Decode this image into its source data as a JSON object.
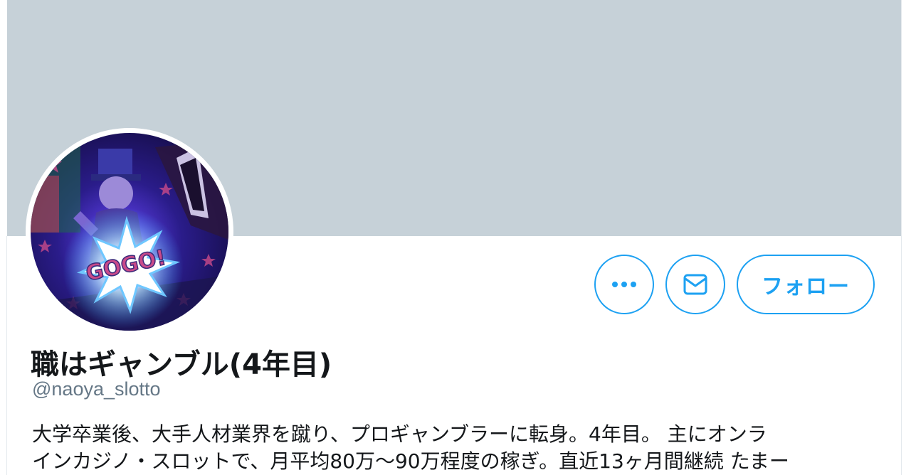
{
  "profile": {
    "display_name": "職はギャンブル(4年目)",
    "handle": "@naoya_slotto",
    "bio_lines": [
      "大学卒業後、大手人材業界を蹴り、プロギャンブラーに転身。4年目。 主にオンラ",
      "インカジノ・スロットで、月平均80万〜90万程度の稼ぎ。直近13ヶ月間継続 たまー"
    ],
    "avatar_badge_text": "GOGO!"
  },
  "actions": {
    "more_icon": "more-dots-icon",
    "message_icon": "envelope-icon",
    "follow_label": "フォロー"
  },
  "colors": {
    "banner": "#c6d1d8",
    "accent": "#1da1f2",
    "name": "#14171a",
    "handle": "#657786"
  }
}
